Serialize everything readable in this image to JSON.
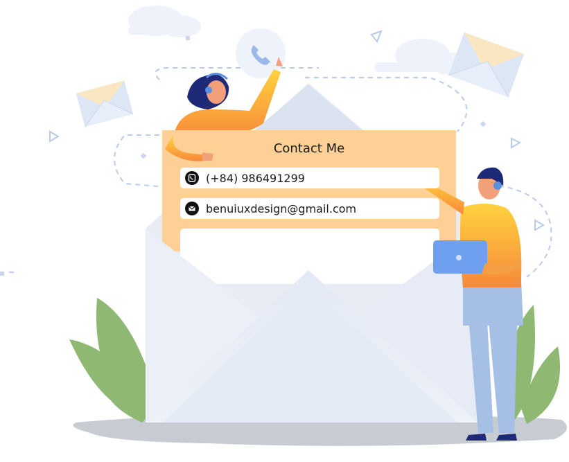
{
  "contact_card": {
    "title": "Contact Me",
    "phone": "(+84) 986491299",
    "email": "benuiuxdesign@gmail.com",
    "phone_icon": "phone-icon",
    "email_icon": "mail-icon"
  },
  "colors": {
    "card": "#fdd196",
    "envelope": "#e8edf6",
    "leaf": "#8fb873",
    "shirt": "#f6a43b",
    "pants": "#a6bfe4",
    "ground": "#c7ccd3"
  }
}
